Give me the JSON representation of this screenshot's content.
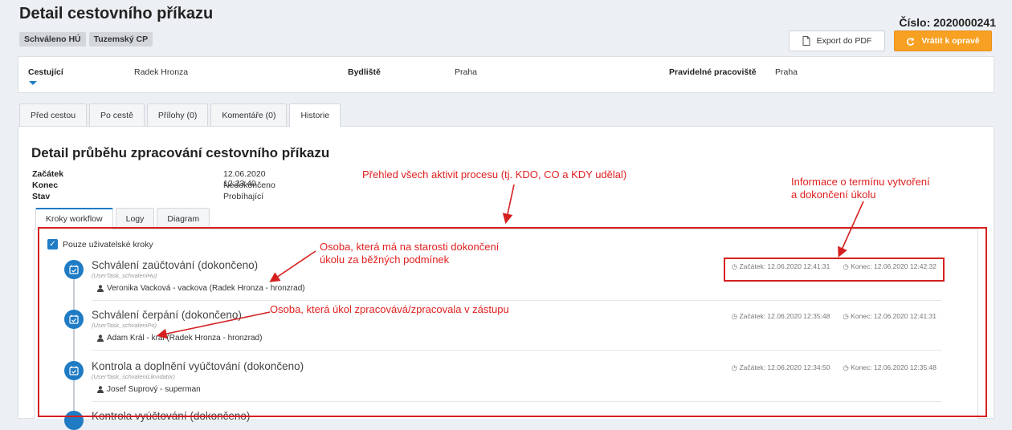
{
  "header": {
    "title": "Detail cestovního příkazu",
    "badges": [
      "Schváleno HÚ",
      "Tuzemský CP"
    ],
    "number": "Číslo: 2020000241",
    "export_label": "Export do PDF",
    "return_label": "Vrátit k opravě"
  },
  "info": {
    "traveler_label": "Cestující",
    "traveler_value": "Radek Hronza",
    "residence_label": "Bydliště",
    "residence_value": "Praha",
    "workplace_label": "Pravidelné pracoviště",
    "workplace_value": "Praha"
  },
  "tabs": [
    "Před cestou",
    "Po cestě",
    "Přílohy (0)",
    "Komentáře (0)",
    "Historie"
  ],
  "detail": {
    "title": "Detail průběhu zpracování cestovního příkazu",
    "start_label": "Začátek",
    "start_value": "12.06.2020 12:23:40",
    "end_label": "Konec",
    "end_value": "Nedokončeno",
    "state_label": "Stav",
    "state_value": "Probíhající"
  },
  "subtabs": [
    "Kroky workflow",
    "Logy",
    "Diagram"
  ],
  "filter": {
    "label": "Pouze uživatelské kroky"
  },
  "steps": [
    {
      "title": "Schválení zaúčtování (dokončeno)",
      "task": "(UserTask_schvaleniHu)",
      "user": "Veronika Vacková - vackova (Radek Hronza - hronzrad)",
      "start": "Začátek: 12.06.2020 12:41:31",
      "end": "Konec: 12.06.2020 12:42:32"
    },
    {
      "title": "Schválení čerpání (dokončeno)",
      "task": "(UserTask_schvaleniPo)",
      "user": "Adam Král - kral (Radek Hronza - hronzrad)",
      "start": "Začátek: 12.06.2020 12:35:48",
      "end": "Konec: 12.06.2020 12:41:31"
    },
    {
      "title": "Kontrola a doplnění vyúčtování (dokončeno)",
      "task": "(UserTask_schvaleniLikvidator)",
      "user": "Josef Suprový - superman",
      "start": "Začátek: 12.06.2020 12:34:50",
      "end": "Konec: 12.06.2020 12:35:48"
    },
    {
      "title": "Kontrola vyúčtování (dokončeno)"
    }
  ],
  "annotations": {
    "overview": "Přehled všech aktivit procesu (tj. KDO, CO a KDY udělal)",
    "dates_line1": "Informace o termínu vytvoření",
    "dates_line2": "a dokončení úkolu",
    "owner_line1": "Osoba, která má na starosti dokončení",
    "owner_line2": "úkolu za běžných podmínek",
    "deputy": "Osoba, která úkol zpracovává/zpracovala v zástupu"
  },
  "colors": {
    "accent": "#1e7bc4",
    "warning": "#f8a021",
    "annotation": "#e02020"
  }
}
